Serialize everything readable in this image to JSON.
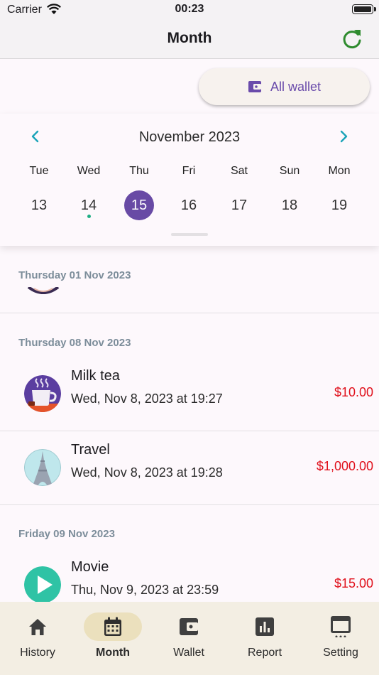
{
  "status_bar": {
    "carrier": "Carrier",
    "time": "00:23"
  },
  "navbar": {
    "title": "Month"
  },
  "wallet_selector": {
    "label": "All wallet"
  },
  "calendar": {
    "month_label": "November 2023",
    "weekdays": [
      "Tue",
      "Wed",
      "Thu",
      "Fri",
      "Sat",
      "Sun",
      "Mon"
    ],
    "days": [
      "13",
      "14",
      "15",
      "16",
      "17",
      "18",
      "19"
    ],
    "selected_day": "15",
    "days_with_entries": [
      "14"
    ]
  },
  "sections": [
    {
      "header": "Thursday 01 Nov 2023",
      "transactions": []
    },
    {
      "header": "Thursday 08 Nov 2023",
      "transactions": [
        {
          "name": "Milk tea",
          "datetime": "Wed, Nov 8, 2023 at 19:27",
          "amount": "$10.00",
          "icon": "milk-tea-icon"
        },
        {
          "name": "Travel",
          "datetime": "Wed, Nov 8, 2023 at 19:28",
          "amount": "$1,000.00",
          "icon": "eiffel-tower-icon"
        }
      ]
    },
    {
      "header": "Friday 09 Nov 2023",
      "transactions": [
        {
          "name": "Movie",
          "datetime": "Thu, Nov 9, 2023 at 23:59",
          "amount": "$15.00",
          "icon": "play-icon"
        }
      ]
    }
  ],
  "bottom_nav": {
    "items": [
      {
        "label": "History",
        "icon": "home-icon"
      },
      {
        "label": "Month",
        "icon": "calendar-icon",
        "active": true
      },
      {
        "label": "Wallet",
        "icon": "wallet-icon"
      },
      {
        "label": "Report",
        "icon": "bar-chart-icon"
      },
      {
        "label": "Setting",
        "icon": "settings-card-icon"
      }
    ]
  },
  "colors": {
    "accent_purple": "#684aa5",
    "expense_red": "#e0101b",
    "refresh_green": "#2e8b2e",
    "chevron_teal": "#1aa3b8",
    "nav_active_pill": "#ebe0bd"
  }
}
